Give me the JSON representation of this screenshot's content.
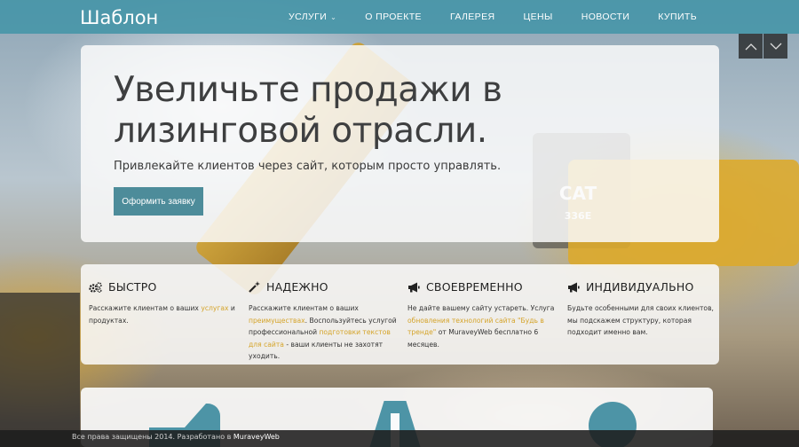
{
  "header": {
    "logo": "Шаблон",
    "nav": [
      {
        "label": "УСЛУГИ",
        "has_dropdown": true
      },
      {
        "label": "О ПРОЕКТЕ"
      },
      {
        "label": "ГАЛЕРЕЯ"
      },
      {
        "label": "ЦЕНЫ"
      },
      {
        "label": "НОВОСТИ"
      },
      {
        "label": "КУПИТЬ"
      }
    ]
  },
  "slider": {
    "prev_icon": "chevron-up-icon",
    "next_icon": "chevron-down-icon"
  },
  "hero": {
    "title": "Увеличьте продажи в лизинговой отрасли.",
    "subtitle": "Привлекайте клиентов через сайт, которым просто управлять.",
    "cta_label": "Оформить заявку"
  },
  "features": [
    {
      "icon": "gears-icon",
      "title": "БЫСТРО",
      "text_parts": [
        "Расскажите клиентам о ваших ",
        "услугах",
        " и продуктах."
      ]
    },
    {
      "icon": "magic-wand-icon",
      "title": "НАДЕЖНО",
      "text_parts": [
        "Расскажите клиентам о ваших ",
        "преимуществах",
        ". Воспользуйтесь услугой профессиональной ",
        "подготовки текстов для сайта",
        " - ваши клиенты не захотят уходить."
      ]
    },
    {
      "icon": "megaphone-icon",
      "title": "СВОЕВРЕМЕННО",
      "text_parts": [
        "Не дайте вашему сайту устареть. Услуга ",
        "обновления технологий сайта \"Будь в тренде\"",
        " от MuraveyWeb бесплатно 6 месяцев."
      ]
    },
    {
      "icon": "megaphone-icon",
      "title": "ИНДИВИДУАЛЬНО",
      "text_parts": [
        "Будьте особенными для своих клиентов, мы подскажем структуру, которая подходит именно вам."
      ]
    }
  ],
  "footer": {
    "copyright": "Все права защищены 2014. Разработано в ",
    "brand": "MuraveyWeb"
  },
  "colors": {
    "nav_bg": "#4896a8",
    "cta_bg": "#4d8c9a",
    "link": "#d5a42a",
    "accent_shape": "#4d94a6"
  }
}
